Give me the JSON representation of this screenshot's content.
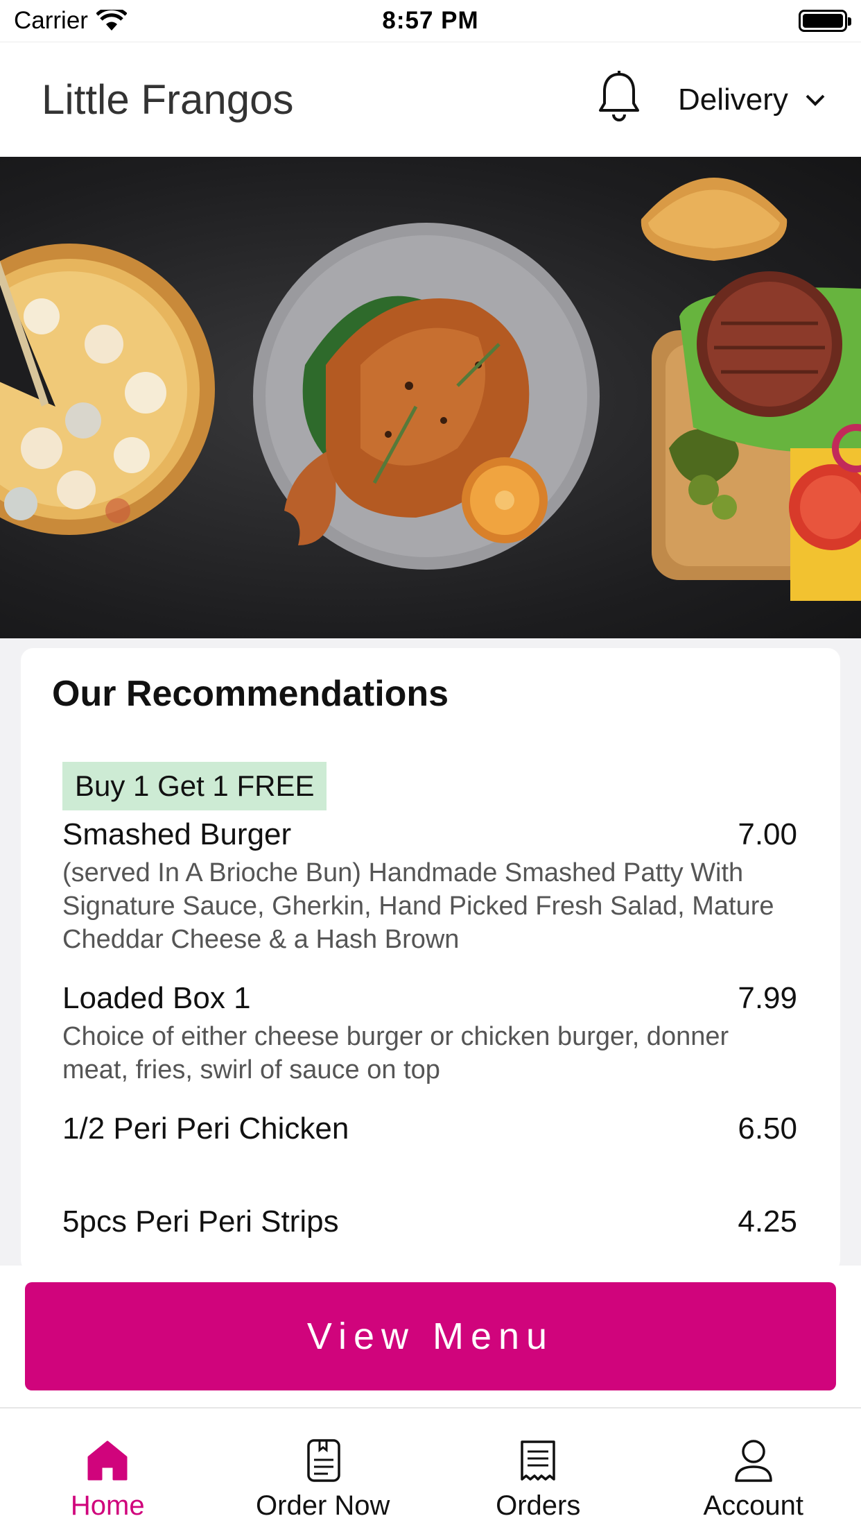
{
  "status_bar": {
    "carrier": "Carrier",
    "time": "8:57 PM"
  },
  "header": {
    "title": "Little Frangos",
    "mode_label": "Delivery"
  },
  "recommendations": {
    "title": "Our Recommendations",
    "badge": "Buy 1 Get 1 FREE",
    "items": [
      {
        "name": "Smashed Burger",
        "price": "7.00",
        "description": "(served In A Brioche Bun) Handmade Smashed Patty With Signature Sauce, Gherkin, Hand Picked Fresh Salad, Mature Cheddar Cheese & a Hash Brown"
      },
      {
        "name": "Loaded Box 1",
        "price": "7.99",
        "description": "Choice of either cheese burger or chicken burger, donner meat, fries, swirl of sauce on top"
      },
      {
        "name": "1/2 Peri Peri Chicken",
        "price": "6.50",
        "description": ""
      },
      {
        "name": "5pcs Peri Peri Strips",
        "price": "4.25",
        "description": ""
      }
    ]
  },
  "cta": {
    "view_menu_label": "View Menu"
  },
  "tabs": [
    {
      "label": "Home",
      "icon": "home-icon",
      "active": true
    },
    {
      "label": "Order Now",
      "icon": "order-book-icon",
      "active": false
    },
    {
      "label": "Orders",
      "icon": "receipt-icon",
      "active": false
    },
    {
      "label": "Account",
      "icon": "user-icon",
      "active": false
    }
  ],
  "colors": {
    "accent": "#d0047c",
    "badge_bg": "#cdebd4"
  }
}
